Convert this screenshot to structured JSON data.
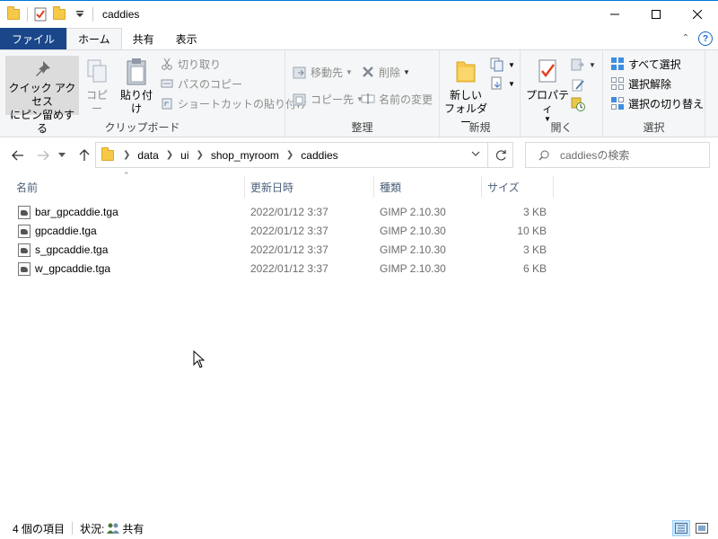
{
  "window": {
    "title": "caddies",
    "icons": [
      "folder-icon",
      "properties-check-icon",
      "new-folder-icon",
      "customize-dropdown-icon"
    ]
  },
  "ribbon_tabs": [
    {
      "label": "ファイル"
    },
    {
      "label": "ホーム"
    },
    {
      "label": "共有"
    },
    {
      "label": "表示"
    }
  ],
  "ribbon": {
    "clipboard": {
      "label": "クリップボード",
      "pin_quick_access_line1": "クイック アクセス",
      "pin_quick_access_line2": "にピン留めする",
      "copy": "コピー",
      "paste": "貼り付け",
      "cut": "切り取り",
      "copy_path": "パスのコピー",
      "paste_shortcut": "ショートカットの貼り付け"
    },
    "organize": {
      "label": "整理",
      "move_to": "移動先",
      "copy_to": "コピー先",
      "delete": "削除",
      "rename": "名前の変更"
    },
    "new": {
      "label": "新規",
      "new_folder_line1": "新しい",
      "new_folder_line2": "フォルダー"
    },
    "open": {
      "label": "開く",
      "properties": "プロパティ"
    },
    "select": {
      "label": "選択",
      "select_all": "すべて選択",
      "select_none": "選択解除",
      "invert_selection": "選択の切り替え"
    }
  },
  "address": {
    "breadcrumbs": [
      "data",
      "ui",
      "shop_myroom",
      "caddies"
    ]
  },
  "search": {
    "placeholder": "caddiesの検索"
  },
  "columns": {
    "name": "名前",
    "date": "更新日時",
    "type": "種類",
    "size": "サイズ"
  },
  "files": [
    {
      "name": "bar_gpcaddie.tga",
      "date": "2022/01/12 3:37",
      "type": "GIMP 2.10.30",
      "size": "3 KB"
    },
    {
      "name": "gpcaddie.tga",
      "date": "2022/01/12 3:37",
      "type": "GIMP 2.10.30",
      "size": "10 KB"
    },
    {
      "name": "s_gpcaddie.tga",
      "date": "2022/01/12 3:37",
      "type": "GIMP 2.10.30",
      "size": "3 KB"
    },
    {
      "name": "w_gpcaddie.tga",
      "date": "2022/01/12 3:37",
      "type": "GIMP 2.10.30",
      "size": "6 KB"
    }
  ],
  "status": {
    "item_count": "4 個の項目",
    "state_label": "状況:",
    "state_value": "共有"
  },
  "colors": {
    "file_tab": "#19478a",
    "accent": "#0078d7",
    "folder": "#f7c948"
  }
}
